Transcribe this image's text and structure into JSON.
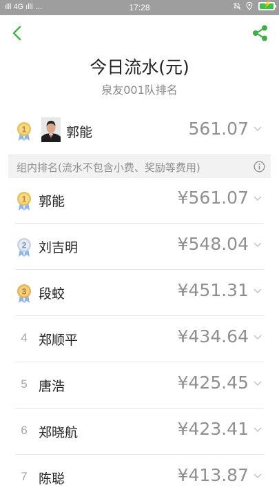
{
  "status_bar": {
    "signal_left": "ılll 4G ılll …",
    "time": "17:28"
  },
  "header": {
    "title": "今日流水(元)",
    "subtitle": "泉友001队排名"
  },
  "top_card": {
    "rank": 1,
    "name": "郭能",
    "amount": "561.07"
  },
  "note": {
    "text": "组内排名(流水不包含小费、奖励等费用)"
  },
  "ranking": [
    {
      "rank": "1",
      "name": "郭能",
      "amount": "¥561.07",
      "medal": "gold"
    },
    {
      "rank": "2",
      "name": "刘吉明",
      "amount": "¥548.04",
      "medal": "silver"
    },
    {
      "rank": "3",
      "name": "段蛟",
      "amount": "¥451.31",
      "medal": "bronze"
    },
    {
      "rank": "4",
      "name": "郑顺平",
      "amount": "¥434.64",
      "medal": ""
    },
    {
      "rank": "5",
      "name": "唐浩",
      "amount": "¥425.45",
      "medal": ""
    },
    {
      "rank": "6",
      "name": "郑晓航",
      "amount": "¥423.41",
      "medal": ""
    },
    {
      "rank": "7",
      "name": "陈聪",
      "amount": "¥413.87",
      "medal": ""
    }
  ],
  "colors": {
    "accent_green": "#3fae49",
    "gold": "#e9c15a",
    "silver": "#c9d3e6",
    "bronze": "#e4b45a",
    "ribbon_blue": "#8fb6e6"
  },
  "icons": {
    "back": "back-arrow-icon",
    "share": "share-icon",
    "info": "info-icon",
    "chevron": "chevron-down-icon"
  }
}
